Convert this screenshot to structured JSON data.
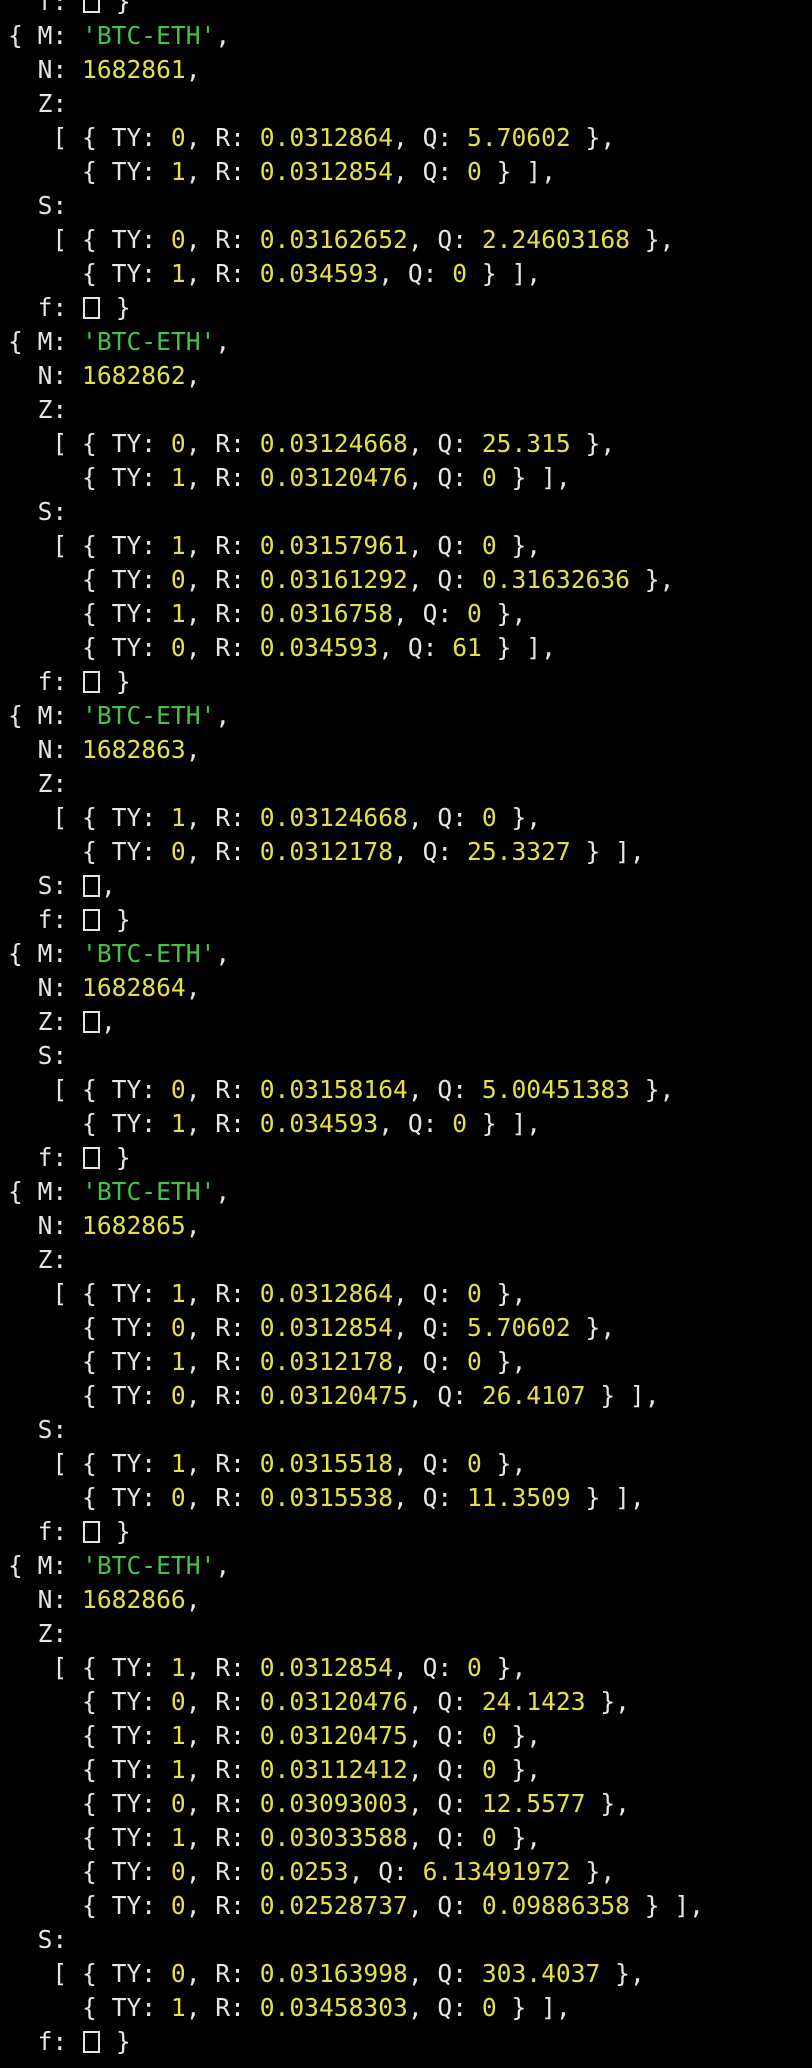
{
  "terminal": {
    "colors": {
      "background": "#000000",
      "text": "#e6e6e6",
      "string": "#46c346",
      "number": "#e5e04a"
    },
    "lines": [
      [
        {
          "t": "  f: "
        },
        {
          "box": true
        },
        {
          "t": " }"
        }
      ],
      [
        {
          "t": "{ M: "
        },
        {
          "s": "'BTC-ETH'"
        },
        {
          "t": ","
        }
      ],
      [
        {
          "t": "  N: "
        },
        {
          "n": "1682861"
        },
        {
          "t": ","
        }
      ],
      [
        {
          "t": "  Z:"
        }
      ],
      [
        {
          "t": "   [ { TY: "
        },
        {
          "n": "0"
        },
        {
          "t": ", R: "
        },
        {
          "n": "0.0312864"
        },
        {
          "t": ", Q: "
        },
        {
          "n": "5.70602"
        },
        {
          "t": " },"
        }
      ],
      [
        {
          "t": "     { TY: "
        },
        {
          "n": "1"
        },
        {
          "t": ", R: "
        },
        {
          "n": "0.0312854"
        },
        {
          "t": ", Q: "
        },
        {
          "n": "0"
        },
        {
          "t": " } ],"
        }
      ],
      [
        {
          "t": "  S:"
        }
      ],
      [
        {
          "t": "   [ { TY: "
        },
        {
          "n": "0"
        },
        {
          "t": ", R: "
        },
        {
          "n": "0.03162652"
        },
        {
          "t": ", Q: "
        },
        {
          "n": "2.24603168"
        },
        {
          "t": " },"
        }
      ],
      [
        {
          "t": "     { TY: "
        },
        {
          "n": "1"
        },
        {
          "t": ", R: "
        },
        {
          "n": "0.034593"
        },
        {
          "t": ", Q: "
        },
        {
          "n": "0"
        },
        {
          "t": " } ],"
        }
      ],
      [
        {
          "t": "  f: "
        },
        {
          "box": true
        },
        {
          "t": " }"
        }
      ],
      [
        {
          "t": "{ M: "
        },
        {
          "s": "'BTC-ETH'"
        },
        {
          "t": ","
        }
      ],
      [
        {
          "t": "  N: "
        },
        {
          "n": "1682862"
        },
        {
          "t": ","
        }
      ],
      [
        {
          "t": "  Z:"
        }
      ],
      [
        {
          "t": "   [ { TY: "
        },
        {
          "n": "0"
        },
        {
          "t": ", R: "
        },
        {
          "n": "0.03124668"
        },
        {
          "t": ", Q: "
        },
        {
          "n": "25.315"
        },
        {
          "t": " },"
        }
      ],
      [
        {
          "t": "     { TY: "
        },
        {
          "n": "1"
        },
        {
          "t": ", R: "
        },
        {
          "n": "0.03120476"
        },
        {
          "t": ", Q: "
        },
        {
          "n": "0"
        },
        {
          "t": " } ],"
        }
      ],
      [
        {
          "t": "  S:"
        }
      ],
      [
        {
          "t": "   [ { TY: "
        },
        {
          "n": "1"
        },
        {
          "t": ", R: "
        },
        {
          "n": "0.03157961"
        },
        {
          "t": ", Q: "
        },
        {
          "n": "0"
        },
        {
          "t": " },"
        }
      ],
      [
        {
          "t": "     { TY: "
        },
        {
          "n": "0"
        },
        {
          "t": ", R: "
        },
        {
          "n": "0.03161292"
        },
        {
          "t": ", Q: "
        },
        {
          "n": "0.31632636"
        },
        {
          "t": " },"
        }
      ],
      [
        {
          "t": "     { TY: "
        },
        {
          "n": "1"
        },
        {
          "t": ", R: "
        },
        {
          "n": "0.0316758"
        },
        {
          "t": ", Q: "
        },
        {
          "n": "0"
        },
        {
          "t": " },"
        }
      ],
      [
        {
          "t": "     { TY: "
        },
        {
          "n": "0"
        },
        {
          "t": ", R: "
        },
        {
          "n": "0.034593"
        },
        {
          "t": ", Q: "
        },
        {
          "n": "61"
        },
        {
          "t": " } ],"
        }
      ],
      [
        {
          "t": "  f: "
        },
        {
          "box": true
        },
        {
          "t": " }"
        }
      ],
      [
        {
          "t": "{ M: "
        },
        {
          "s": "'BTC-ETH'"
        },
        {
          "t": ","
        }
      ],
      [
        {
          "t": "  N: "
        },
        {
          "n": "1682863"
        },
        {
          "t": ","
        }
      ],
      [
        {
          "t": "  Z:"
        }
      ],
      [
        {
          "t": "   [ { TY: "
        },
        {
          "n": "1"
        },
        {
          "t": ", R: "
        },
        {
          "n": "0.03124668"
        },
        {
          "t": ", Q: "
        },
        {
          "n": "0"
        },
        {
          "t": " },"
        }
      ],
      [
        {
          "t": "     { TY: "
        },
        {
          "n": "0"
        },
        {
          "t": ", R: "
        },
        {
          "n": "0.0312178"
        },
        {
          "t": ", Q: "
        },
        {
          "n": "25.3327"
        },
        {
          "t": " } ],"
        }
      ],
      [
        {
          "t": "  S: "
        },
        {
          "box": true
        },
        {
          "t": ","
        }
      ],
      [
        {
          "t": "  f: "
        },
        {
          "box": true
        },
        {
          "t": " }"
        }
      ],
      [
        {
          "t": "{ M: "
        },
        {
          "s": "'BTC-ETH'"
        },
        {
          "t": ","
        }
      ],
      [
        {
          "t": "  N: "
        },
        {
          "n": "1682864"
        },
        {
          "t": ","
        }
      ],
      [
        {
          "t": "  Z: "
        },
        {
          "box": true
        },
        {
          "t": ","
        }
      ],
      [
        {
          "t": "  S:"
        }
      ],
      [
        {
          "t": "   [ { TY: "
        },
        {
          "n": "0"
        },
        {
          "t": ", R: "
        },
        {
          "n": "0.03158164"
        },
        {
          "t": ", Q: "
        },
        {
          "n": "5.00451383"
        },
        {
          "t": " },"
        }
      ],
      [
        {
          "t": "     { TY: "
        },
        {
          "n": "1"
        },
        {
          "t": ", R: "
        },
        {
          "n": "0.034593"
        },
        {
          "t": ", Q: "
        },
        {
          "n": "0"
        },
        {
          "t": " } ],"
        }
      ],
      [
        {
          "t": "  f: "
        },
        {
          "box": true
        },
        {
          "t": " }"
        }
      ],
      [
        {
          "t": "{ M: "
        },
        {
          "s": "'BTC-ETH'"
        },
        {
          "t": ","
        }
      ],
      [
        {
          "t": "  N: "
        },
        {
          "n": "1682865"
        },
        {
          "t": ","
        }
      ],
      [
        {
          "t": "  Z:"
        }
      ],
      [
        {
          "t": "   [ { TY: "
        },
        {
          "n": "1"
        },
        {
          "t": ", R: "
        },
        {
          "n": "0.0312864"
        },
        {
          "t": ", Q: "
        },
        {
          "n": "0"
        },
        {
          "t": " },"
        }
      ],
      [
        {
          "t": "     { TY: "
        },
        {
          "n": "0"
        },
        {
          "t": ", R: "
        },
        {
          "n": "0.0312854"
        },
        {
          "t": ", Q: "
        },
        {
          "n": "5.70602"
        },
        {
          "t": " },"
        }
      ],
      [
        {
          "t": "     { TY: "
        },
        {
          "n": "1"
        },
        {
          "t": ", R: "
        },
        {
          "n": "0.0312178"
        },
        {
          "t": ", Q: "
        },
        {
          "n": "0"
        },
        {
          "t": " },"
        }
      ],
      [
        {
          "t": "     { TY: "
        },
        {
          "n": "0"
        },
        {
          "t": ", R: "
        },
        {
          "n": "0.03120475"
        },
        {
          "t": ", Q: "
        },
        {
          "n": "26.4107"
        },
        {
          "t": " } ],"
        }
      ],
      [
        {
          "t": "  S:"
        }
      ],
      [
        {
          "t": "   [ { TY: "
        },
        {
          "n": "1"
        },
        {
          "t": ", R: "
        },
        {
          "n": "0.0315518"
        },
        {
          "t": ", Q: "
        },
        {
          "n": "0"
        },
        {
          "t": " },"
        }
      ],
      [
        {
          "t": "     { TY: "
        },
        {
          "n": "0"
        },
        {
          "t": ", R: "
        },
        {
          "n": "0.0315538"
        },
        {
          "t": ", Q: "
        },
        {
          "n": "11.3509"
        },
        {
          "t": " } ],"
        }
      ],
      [
        {
          "t": "  f: "
        },
        {
          "box": true
        },
        {
          "t": " }"
        }
      ],
      [
        {
          "t": "{ M: "
        },
        {
          "s": "'BTC-ETH'"
        },
        {
          "t": ","
        }
      ],
      [
        {
          "t": "  N: "
        },
        {
          "n": "1682866"
        },
        {
          "t": ","
        }
      ],
      [
        {
          "t": "  Z:"
        }
      ],
      [
        {
          "t": "   [ { TY: "
        },
        {
          "n": "1"
        },
        {
          "t": ", R: "
        },
        {
          "n": "0.0312854"
        },
        {
          "t": ", Q: "
        },
        {
          "n": "0"
        },
        {
          "t": " },"
        }
      ],
      [
        {
          "t": "     { TY: "
        },
        {
          "n": "0"
        },
        {
          "t": ", R: "
        },
        {
          "n": "0.03120476"
        },
        {
          "t": ", Q: "
        },
        {
          "n": "24.1423"
        },
        {
          "t": " },"
        }
      ],
      [
        {
          "t": "     { TY: "
        },
        {
          "n": "1"
        },
        {
          "t": ", R: "
        },
        {
          "n": "0.03120475"
        },
        {
          "t": ", Q: "
        },
        {
          "n": "0"
        },
        {
          "t": " },"
        }
      ],
      [
        {
          "t": "     { TY: "
        },
        {
          "n": "1"
        },
        {
          "t": ", R: "
        },
        {
          "n": "0.03112412"
        },
        {
          "t": ", Q: "
        },
        {
          "n": "0"
        },
        {
          "t": " },"
        }
      ],
      [
        {
          "t": "     { TY: "
        },
        {
          "n": "0"
        },
        {
          "t": ", R: "
        },
        {
          "n": "0.03093003"
        },
        {
          "t": ", Q: "
        },
        {
          "n": "12.5577"
        },
        {
          "t": " },"
        }
      ],
      [
        {
          "t": "     { TY: "
        },
        {
          "n": "1"
        },
        {
          "t": ", R: "
        },
        {
          "n": "0.03033588"
        },
        {
          "t": ", Q: "
        },
        {
          "n": "0"
        },
        {
          "t": " },"
        }
      ],
      [
        {
          "t": "     { TY: "
        },
        {
          "n": "0"
        },
        {
          "t": ", R: "
        },
        {
          "n": "0.0253"
        },
        {
          "t": ", Q: "
        },
        {
          "n": "6.13491972"
        },
        {
          "t": " },"
        }
      ],
      [
        {
          "t": "     { TY: "
        },
        {
          "n": "0"
        },
        {
          "t": ", R: "
        },
        {
          "n": "0.02528737"
        },
        {
          "t": ", Q: "
        },
        {
          "n": "0.09886358"
        },
        {
          "t": " } ],"
        }
      ],
      [
        {
          "t": "  S:"
        }
      ],
      [
        {
          "t": "   [ { TY: "
        },
        {
          "n": "0"
        },
        {
          "t": ", R: "
        },
        {
          "n": "0.03163998"
        },
        {
          "t": ", Q: "
        },
        {
          "n": "303.4037"
        },
        {
          "t": " },"
        }
      ],
      [
        {
          "t": "     { TY: "
        },
        {
          "n": "1"
        },
        {
          "t": ", R: "
        },
        {
          "n": "0.03458303"
        },
        {
          "t": ", Q: "
        },
        {
          "n": "0"
        },
        {
          "t": " } ],"
        }
      ],
      [
        {
          "t": "  f: "
        },
        {
          "box": true
        },
        {
          "t": " }"
        }
      ]
    ]
  }
}
